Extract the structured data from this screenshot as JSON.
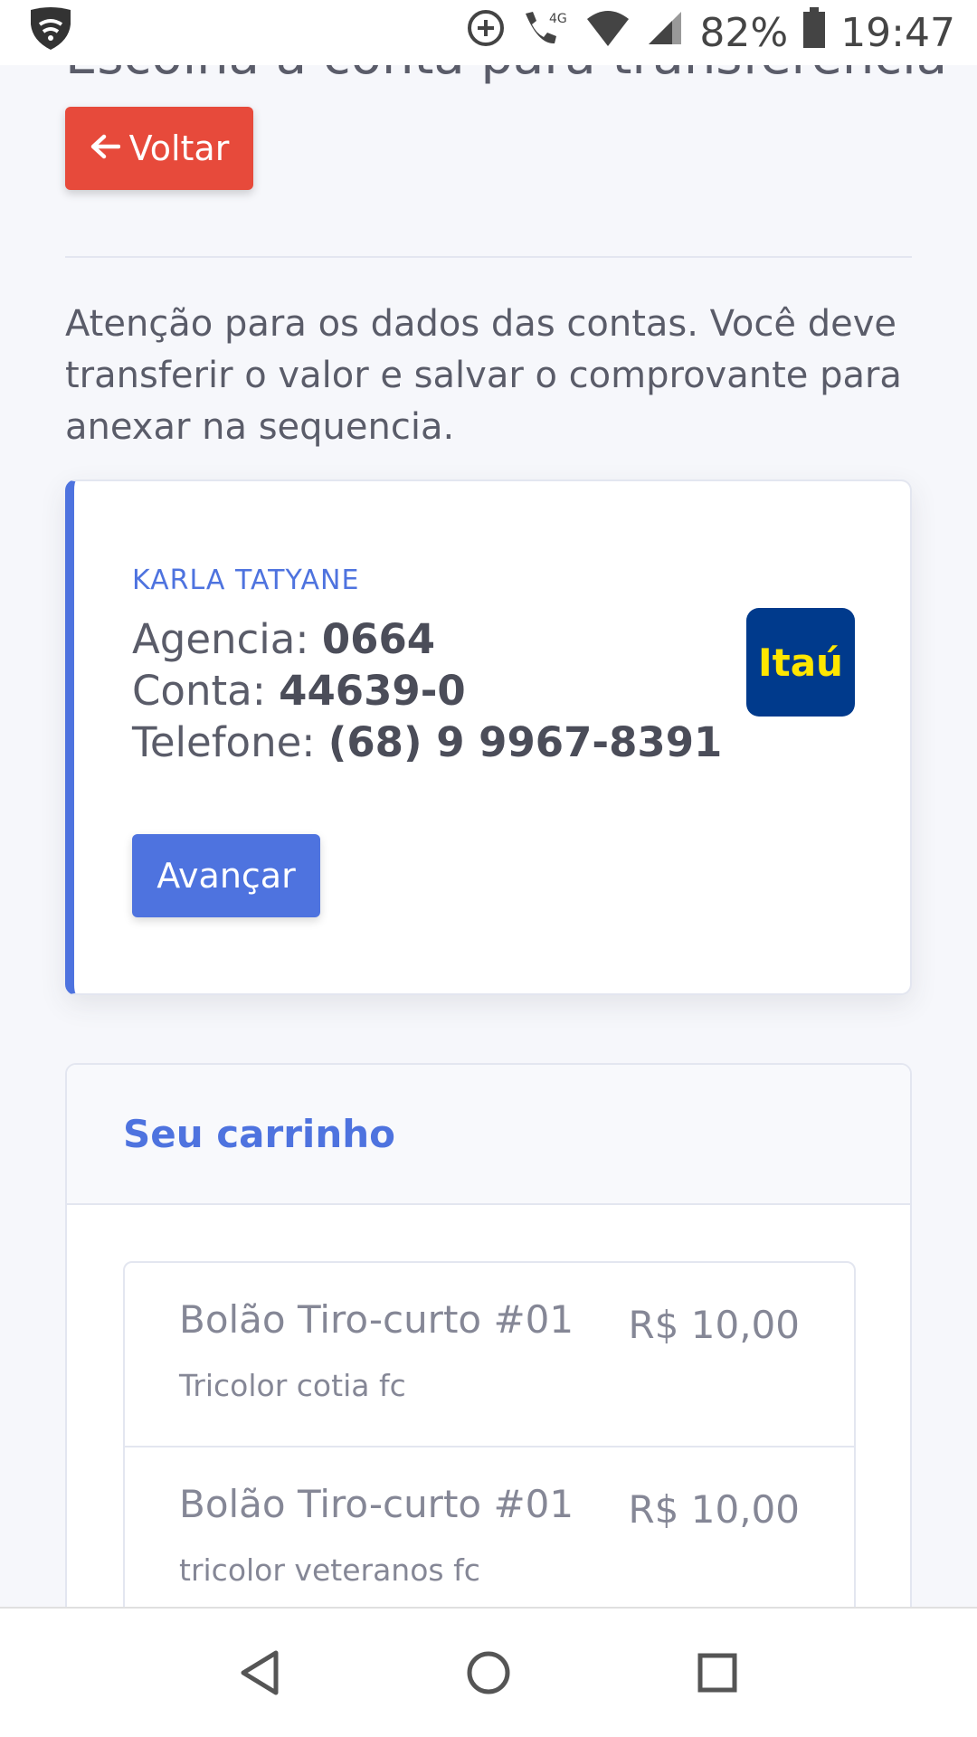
{
  "status_bar": {
    "battery": "82%",
    "time": "19:47",
    "network": "4G"
  },
  "page": {
    "heading_partial": "Escolha a conta para transferência",
    "back_label": "Voltar",
    "notice": "Atenção para os dados das contas. Você deve transferir o valor e salvar o comprovante para anexar na sequencia."
  },
  "account": {
    "holder": "KARLA TATYANE",
    "agencia_label": "Agencia:",
    "agencia_value": "0664",
    "conta_label": "Conta:",
    "conta_value": "44639-0",
    "telefone_label": "Telefone:",
    "telefone_value": "(68) 9 9967-8391",
    "bank_logo_text": "Itaú",
    "advance_label": "Avançar"
  },
  "cart": {
    "title": "Seu carrinho",
    "items": [
      {
        "name": "Bolão Tiro-curto #01",
        "price": "R$ 10,00",
        "team": "Tricolor cotia fc"
      },
      {
        "name": "Bolão Tiro-curto #01",
        "price": "R$ 10,00",
        "team": "tricolor veteranos fc"
      }
    ]
  },
  "colors": {
    "primary": "#4e73df",
    "danger": "#e74a3b",
    "bank_blue": "#003a8c",
    "bank_yellow": "#ffe600"
  },
  "icons": [
    "vpn-shield-icon",
    "data-saver-icon",
    "volte-call-icon",
    "wifi-icon",
    "signal-icon",
    "battery-icon",
    "back-triangle-icon",
    "home-circle-icon",
    "recents-square-icon"
  ]
}
